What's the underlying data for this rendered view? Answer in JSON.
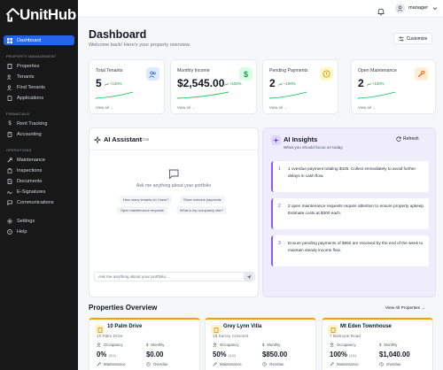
{
  "app": {
    "logo_text": "UnitHub"
  },
  "sidebar": {
    "top_items": [
      {
        "label": "Dashboard",
        "icon": "dashboard-icon",
        "active": true
      }
    ],
    "sections": [
      {
        "label": "PROPERTY MANAGEMENT",
        "items": [
          {
            "label": "Properties",
            "icon": "building-icon"
          },
          {
            "label": "Tenants",
            "icon": "users-icon"
          },
          {
            "label": "Find Tenants",
            "icon": "user-search-icon"
          },
          {
            "label": "Applications",
            "icon": "file-icon"
          }
        ]
      },
      {
        "label": "FINANCIALS",
        "items": [
          {
            "label": "Rent Tracking",
            "icon": "dollar-icon"
          },
          {
            "label": "Accounting",
            "icon": "calculator-icon"
          }
        ]
      },
      {
        "label": "OPERATIONS",
        "items": [
          {
            "label": "Maintenance",
            "icon": "wrench-icon"
          },
          {
            "label": "Inspections",
            "icon": "clipboard-icon"
          },
          {
            "label": "Documents",
            "icon": "document-icon"
          },
          {
            "label": "E-Signatures",
            "icon": "signature-icon"
          },
          {
            "label": "Communications",
            "icon": "message-icon"
          }
        ]
      }
    ],
    "bottom_items": [
      {
        "label": "Settings",
        "icon": "gear-icon"
      },
      {
        "label": "Help",
        "icon": "help-icon"
      }
    ]
  },
  "topbar": {
    "username": "manager"
  },
  "header": {
    "title": "Dashboard",
    "subtitle": "Welcome back! Here's your property overview.",
    "customize_label": "Customize"
  },
  "stats": [
    {
      "label": "Total Tenants",
      "value": "5",
      "change": "+100%",
      "view_all": "View all →",
      "icon": "users-icon",
      "icon_bg": "#dbeafe",
      "icon_color": "#2563eb"
    },
    {
      "label": "Monthly Income",
      "value": "$2,545.00",
      "change": "+100%",
      "view_all": "View all →",
      "icon": "dollar-icon",
      "icon_bg": "#dcfce7",
      "icon_color": "#16a34a"
    },
    {
      "label": "Pending Payments",
      "value": "2",
      "change": "+100%",
      "view_all": "View all →",
      "icon": "clock-icon",
      "icon_bg": "#fef9c3",
      "icon_color": "#ca8a04"
    },
    {
      "label": "Open Maintenance",
      "value": "2",
      "change": "+100%",
      "view_all": "View all →",
      "icon": "wrench-icon",
      "icon_bg": "#ffedd5",
      "icon_color": "#ea580c"
    }
  ],
  "assistant": {
    "title": "AI Assistant",
    "tag": "Chat",
    "prompt": "Ask me anything about your portfolio",
    "suggestions": [
      "How many tenants do I have?",
      "Show overdue payments",
      "Open maintenance requests",
      "What is my occupancy rate?"
    ],
    "input_placeholder": "Ask me anything about your portfolio..."
  },
  "insights": {
    "title": "AI Insights",
    "subtitle": "What you should focus on today",
    "refresh_label": "Refresh",
    "items": [
      {
        "num": "1",
        "text": "1 overdue payment totaling $425. Collect immediately to avoid further delays in cash flow."
      },
      {
        "num": "2",
        "text": "2 open maintenance requests require attention to ensure property upkeep. Estimate costs at $300 each."
      },
      {
        "num": "3",
        "text": "Ensure pending payments of $850 are received by the end of the week to maintain steady income flow."
      }
    ]
  },
  "properties": {
    "title": "Properties Overview",
    "view_all": "View All Properties →",
    "occupancy_label": "Occupancy",
    "monthly_label": "Monthly",
    "maintenance_label": "Maintenance",
    "overdue_label": "Overdue",
    "items": [
      {
        "name": "10 Palm Drive",
        "address": "10 Palm Drive",
        "occupancy": "0%",
        "units": "(0/1)",
        "monthly": "$0.00"
      },
      {
        "name": "Grey Lynn Villa",
        "address": "18 Surrey Crescent",
        "occupancy": "50%",
        "units": "(1/2)",
        "monthly": "$850.00"
      },
      {
        "name": "Mt Eden Townhouse",
        "address": "7 Balmoral Road",
        "occupancy": "100%",
        "units": "(1/1)",
        "monthly": "$1,040.00"
      }
    ]
  }
}
